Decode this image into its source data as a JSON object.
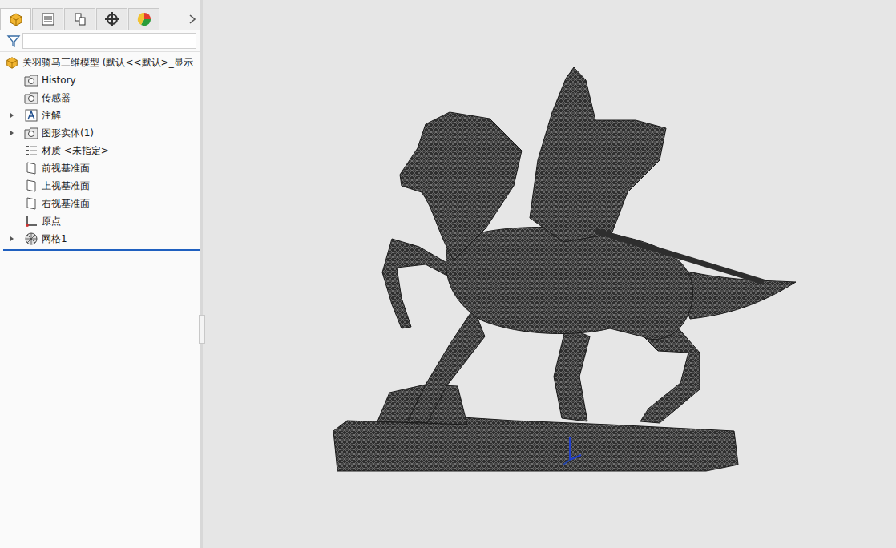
{
  "tabs": [
    {
      "kind": "feature",
      "selected": true
    },
    {
      "kind": "property",
      "selected": false
    },
    {
      "kind": "config",
      "selected": false
    },
    {
      "kind": "dimxpert",
      "selected": false
    },
    {
      "kind": "display",
      "selected": false
    }
  ],
  "filter": {
    "value": ""
  },
  "tree": {
    "root": "关羽骑马三维模型  (默认<<默认>_显示",
    "items": [
      {
        "label": "History",
        "kind": "history",
        "expandable": false
      },
      {
        "label": "传感器",
        "kind": "sensor",
        "expandable": false
      },
      {
        "label": "注解",
        "kind": "annotation",
        "expandable": true
      },
      {
        "label": "图形实体(1)",
        "kind": "bodies",
        "expandable": true
      },
      {
        "label": "材质 <未指定>",
        "kind": "material",
        "expandable": false
      },
      {
        "label": "前视基准面",
        "kind": "plane",
        "expandable": false
      },
      {
        "label": "上视基准面",
        "kind": "plane",
        "expandable": false
      },
      {
        "label": "右视基准面",
        "kind": "plane",
        "expandable": false
      },
      {
        "label": "原点",
        "kind": "origin",
        "expandable": false
      },
      {
        "label": "网格1",
        "kind": "mesh",
        "expandable": true
      }
    ]
  }
}
